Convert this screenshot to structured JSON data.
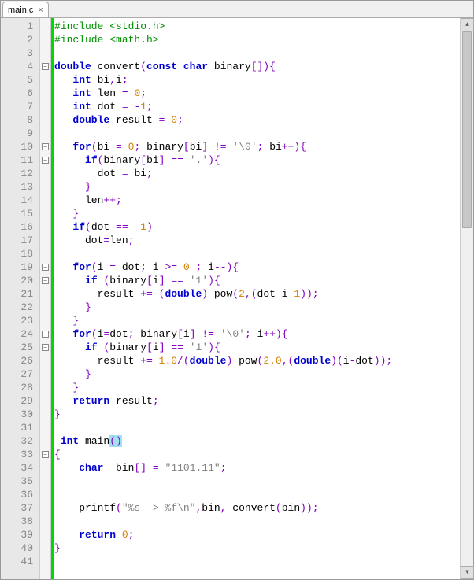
{
  "tab": {
    "label": "main.c",
    "close": "×"
  },
  "lines": [
    {
      "n": 1,
      "fold": "",
      "html": "<span class='hdr'>#include &lt;stdio.h&gt;</span>"
    },
    {
      "n": 2,
      "fold": "",
      "html": "<span class='hdr'>#include &lt;math.h&gt;</span>"
    },
    {
      "n": 3,
      "fold": "",
      "html": ""
    },
    {
      "n": 4,
      "fold": "-",
      "html": "<span class='kw-blue'>double</span> convert<span class='type-purple'>(</span><span class='kw-blue'>const</span> <span class='kw-blue'>char</span> binary<span class='type-purple'>[]){</span>"
    },
    {
      "n": 5,
      "fold": "",
      "html": "   <span class='kw-blue'>int</span> bi<span class='type-purple'>,</span>i<span class='type-purple'>;</span>"
    },
    {
      "n": 6,
      "fold": "",
      "html": "   <span class='kw-blue'>int</span> len <span class='type-purple'>=</span> <span class='num-orange'>0</span><span class='type-purple'>;</span>"
    },
    {
      "n": 7,
      "fold": "",
      "html": "   <span class='kw-blue'>int</span> dot <span class='type-purple'>=</span> <span class='type-purple'>-</span><span class='num-orange'>1</span><span class='type-purple'>;</span>"
    },
    {
      "n": 8,
      "fold": "",
      "html": "   <span class='kw-blue'>double</span> result <span class='type-purple'>=</span> <span class='num-orange'>0</span><span class='type-purple'>;</span>"
    },
    {
      "n": 9,
      "fold": "",
      "html": ""
    },
    {
      "n": 10,
      "fold": "-",
      "html": "   <span class='kw-blue'>for</span><span class='type-purple'>(</span>bi <span class='type-purple'>=</span> <span class='num-orange'>0</span><span class='type-purple'>;</span> binary<span class='type-purple'>[</span>bi<span class='type-purple'>]</span> <span class='type-purple'>!=</span> <span class='str-grey'>'\\0'</span><span class='type-purple'>;</span> bi<span class='type-purple'>++){</span>"
    },
    {
      "n": 11,
      "fold": "-",
      "html": "     <span class='kw-blue'>if</span><span class='type-purple'>(</span>binary<span class='type-purple'>[</span>bi<span class='type-purple'>]</span> <span class='type-purple'>==</span> <span class='str-grey'>'.'</span><span class='type-purple'>){</span>"
    },
    {
      "n": 12,
      "fold": "",
      "html": "       dot <span class='type-purple'>=</span> bi<span class='type-purple'>;</span>"
    },
    {
      "n": 13,
      "fold": "",
      "html": "     <span class='type-purple'>}</span>"
    },
    {
      "n": 14,
      "fold": "",
      "html": "     len<span class='type-purple'>++;</span>"
    },
    {
      "n": 15,
      "fold": "",
      "html": "   <span class='type-purple'>}</span>"
    },
    {
      "n": 16,
      "fold": "",
      "html": "   <span class='kw-blue'>if</span><span class='type-purple'>(</span>dot <span class='type-purple'>==</span> <span class='type-purple'>-</span><span class='num-orange'>1</span><span class='type-purple'>)</span>"
    },
    {
      "n": 17,
      "fold": "",
      "html": "     dot<span class='type-purple'>=</span>len<span class='type-purple'>;</span>"
    },
    {
      "n": 18,
      "fold": "",
      "html": ""
    },
    {
      "n": 19,
      "fold": "-",
      "html": "   <span class='kw-blue'>for</span><span class='type-purple'>(</span>i <span class='type-purple'>=</span> dot<span class='type-purple'>;</span> i <span class='type-purple'>&gt;=</span> <span class='num-orange'>0</span> <span class='type-purple'>;</span> i<span class='type-purple'>--){</span>"
    },
    {
      "n": 20,
      "fold": "-",
      "html": "     <span class='kw-blue'>if</span> <span class='type-purple'>(</span>binary<span class='type-purple'>[</span>i<span class='type-purple'>]</span> <span class='type-purple'>==</span> <span class='str-grey'>'1'</span><span class='type-purple'>){</span>"
    },
    {
      "n": 21,
      "fold": "",
      "html": "       result <span class='type-purple'>+=</span> <span class='type-purple'>(</span><span class='kw-blue'>double</span><span class='type-purple'>)</span> pow<span class='type-purple'>(</span><span class='num-orange'>2</span><span class='type-purple'>,(</span>dot<span class='type-purple'>-</span>i<span class='type-purple'>-</span><span class='num-orange'>1</span><span class='type-purple'>));</span>"
    },
    {
      "n": 22,
      "fold": "",
      "html": "     <span class='type-purple'>}</span>"
    },
    {
      "n": 23,
      "fold": "",
      "html": "   <span class='type-purple'>}</span>"
    },
    {
      "n": 24,
      "fold": "-",
      "html": "   <span class='kw-blue'>for</span><span class='type-purple'>(</span>i<span class='type-purple'>=</span>dot<span class='type-purple'>;</span> binary<span class='type-purple'>[</span>i<span class='type-purple'>]</span> <span class='type-purple'>!=</span> <span class='str-grey'>'\\0'</span><span class='type-purple'>;</span> i<span class='type-purple'>++){</span>"
    },
    {
      "n": 25,
      "fold": "-",
      "html": "     <span class='kw-blue'>if</span> <span class='type-purple'>(</span>binary<span class='type-purple'>[</span>i<span class='type-purple'>]</span> <span class='type-purple'>==</span> <span class='str-grey'>'1'</span><span class='type-purple'>){</span>"
    },
    {
      "n": 26,
      "fold": "",
      "html": "       result <span class='type-purple'>+=</span> <span class='num-orange'>1.0</span><span class='type-purple'>/(</span><span class='kw-blue'>double</span><span class='type-purple'>)</span> pow<span class='type-purple'>(</span><span class='num-orange'>2.0</span><span class='type-purple'>,(</span><span class='kw-blue'>double</span><span class='type-purple'>)(</span>i<span class='type-purple'>-</span>dot<span class='type-purple'>));</span>"
    },
    {
      "n": 27,
      "fold": "",
      "html": "     <span class='type-purple'>}</span>"
    },
    {
      "n": 28,
      "fold": "",
      "html": "   <span class='type-purple'>}</span>"
    },
    {
      "n": 29,
      "fold": "",
      "html": "   <span class='kw-blue'>return</span> result<span class='type-purple'>;</span>"
    },
    {
      "n": 30,
      "fold": "",
      "html": "<span class='type-purple'>}</span>"
    },
    {
      "n": 31,
      "fold": "",
      "html": ""
    },
    {
      "n": 32,
      "fold": "",
      "html": " <span class='kw-blue'>int</span> main<span class='highlight-paren'><span class='type-purple'>()</span></span>"
    },
    {
      "n": 33,
      "fold": "-",
      "html": "<span class='type-purple'>{</span>"
    },
    {
      "n": 34,
      "fold": "",
      "html": "    <span class='kw-blue'>char</span>  bin<span class='type-purple'>[]</span> <span class='type-purple'>=</span> <span class='str-grey'>\"1101.11\"</span><span class='type-purple'>;</span>"
    },
    {
      "n": 35,
      "fold": "",
      "html": ""
    },
    {
      "n": 36,
      "fold": "",
      "html": ""
    },
    {
      "n": 37,
      "fold": "",
      "html": "    printf<span class='type-purple'>(</span><span class='str-grey'>\"%s -&gt; %f\\n\"</span><span class='type-purple'>,</span>bin<span class='type-purple'>,</span> convert<span class='type-purple'>(</span>bin<span class='type-purple'>));</span>"
    },
    {
      "n": 38,
      "fold": "",
      "html": ""
    },
    {
      "n": 39,
      "fold": "",
      "html": "    <span class='kw-blue'>return</span> <span class='num-orange'>0</span><span class='type-purple'>;</span>"
    },
    {
      "n": 40,
      "fold": "",
      "html": "<span class='type-purple'>}</span>"
    },
    {
      "n": 41,
      "fold": "",
      "html": ""
    }
  ],
  "scroll": {
    "up": "▲",
    "down": "▼"
  }
}
